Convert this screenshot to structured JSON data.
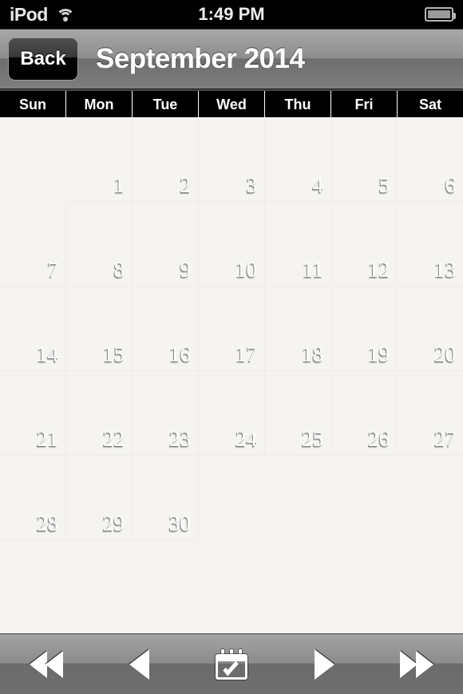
{
  "status_bar": {
    "carrier": "iPod",
    "wifi_icon": "wifi-icon",
    "time": "1:49 PM",
    "battery_icon": "battery-icon"
  },
  "nav_bar": {
    "back_label": "Back",
    "title": "September 2014"
  },
  "calendar": {
    "weekdays": [
      "Sun",
      "Mon",
      "Tue",
      "Wed",
      "Thu",
      "Fri",
      "Sat"
    ],
    "weeks": [
      [
        "",
        "1",
        "2",
        "3",
        "4",
        "5",
        "6"
      ],
      [
        "7",
        "8",
        "9",
        "10",
        "11",
        "12",
        "13"
      ],
      [
        "14",
        "15",
        "16",
        "17",
        "18",
        "19",
        "20"
      ],
      [
        "21",
        "22",
        "23",
        "24",
        "25",
        "26",
        "27"
      ],
      [
        "28",
        "29",
        "30",
        "",
        "",
        "",
        ""
      ],
      [
        "",
        "",
        "",
        "",
        "",
        "",
        ""
      ]
    ]
  },
  "toolbar": {
    "buttons": [
      {
        "name": "rewind-button",
        "icon": "double-left-triangle-icon"
      },
      {
        "name": "previous-button",
        "icon": "left-triangle-icon"
      },
      {
        "name": "today-button",
        "icon": "calendar-check-icon"
      },
      {
        "name": "next-button",
        "icon": "right-triangle-icon"
      },
      {
        "name": "fast-forward-button",
        "icon": "double-right-triangle-icon"
      }
    ]
  },
  "colors": {
    "status_bar_bg": "#000000",
    "nav_bar_top": "#a7a7a7",
    "nav_bar_bottom": "#7e7e7e",
    "weekday_bg": "#000000",
    "cell_bg": "#f5f4f0",
    "day_number": "#ffffff",
    "toolbar_top": "#a3a3a3",
    "toolbar_bottom": "#6f6f6f"
  }
}
